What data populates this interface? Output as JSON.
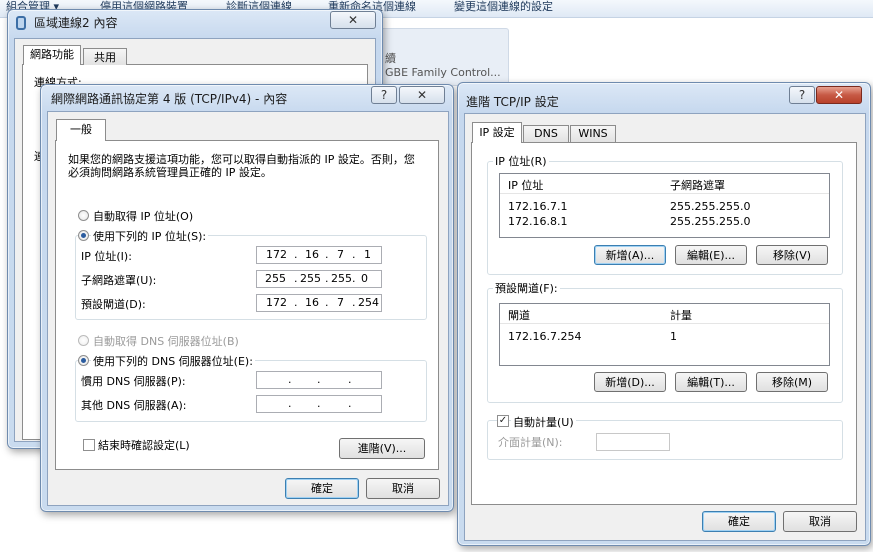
{
  "background": {
    "toolbar": [
      "組合管理 ▾",
      "停用這個網路裝置",
      "診斷這個連線",
      "重新命名這個連線",
      "變更這個連線的設定"
    ],
    "adapter_label": "GBE Family Control...",
    "adapter_label_partial": "續"
  },
  "lan_window": {
    "title": "區域連線2 內容",
    "tabs": [
      "網路功能",
      "共用"
    ],
    "connect_using_label": "連線方式:",
    "partial_label": "連"
  },
  "ipv4_window": {
    "title": "網際網路通訊協定第 4 版 (TCP/IPv4) - 內容",
    "help": "?",
    "close": "X",
    "tab": "一般",
    "description": "如果您的網路支援這項功能，您可以取得自動指派的 IP 設定。否則，您必須詢問網路系統管理員正確的 IP 設定。",
    "auto_ip": "自動取得 IP 位址(O)",
    "manual_ip": "使用下列的 IP 位址(S):",
    "ip_label": "IP 位址(I):",
    "ip_value": [
      "172",
      "16",
      "7",
      "1"
    ],
    "subnet_label": "子網路遮罩(U):",
    "subnet_value": [
      "255",
      "255",
      "255",
      "0"
    ],
    "gateway_label": "預設閘道(D):",
    "gateway_value": [
      "172",
      "16",
      "7",
      "254"
    ],
    "auto_dns": "自動取得 DNS 伺服器位址(B)",
    "manual_dns": "使用下列的 DNS 伺服器位址(E):",
    "preferred_dns_label": "慣用 DNS 伺服器(P):",
    "alternate_dns_label": "其他 DNS 伺服器(A):",
    "validate_label": "結束時確認設定(L)",
    "advanced_button": "進階(V)...",
    "ok_button": "確定",
    "cancel_button": "取消",
    "ip_mode": "manual",
    "dns_mode": "manual",
    "validate_checked": false
  },
  "advanced_window": {
    "title": "進階 TCP/IP 設定",
    "help": "?",
    "close": "X",
    "tabs": [
      "IP 設定",
      "DNS",
      "WINS"
    ],
    "ip_group_label": "IP 位址(R)",
    "ip_columns": [
      "IP 位址",
      "子網路遮罩"
    ],
    "ip_rows": [
      {
        "ip": "172.16.7.1",
        "mask": "255.255.255.0"
      },
      {
        "ip": "172.16.8.1",
        "mask": "255.255.255.0"
      }
    ],
    "ip_add": "新增(A)...",
    "ip_edit": "編輯(E)...",
    "ip_remove": "移除(V)",
    "gateway_group_label": "預設閘道(F):",
    "gateway_columns": [
      "閘道",
      "計量"
    ],
    "gateway_rows": [
      {
        "gateway": "172.16.7.254",
        "metric": "1"
      }
    ],
    "gw_add": "新增(D)...",
    "gw_edit": "編輯(T)...",
    "gw_remove": "移除(M)",
    "auto_metric_label": "自動計量(U)",
    "auto_metric_checked": true,
    "interface_metric_label": "介面計量(N):",
    "interface_metric_value": "",
    "ok_button": "確定",
    "cancel_button": "取消"
  }
}
